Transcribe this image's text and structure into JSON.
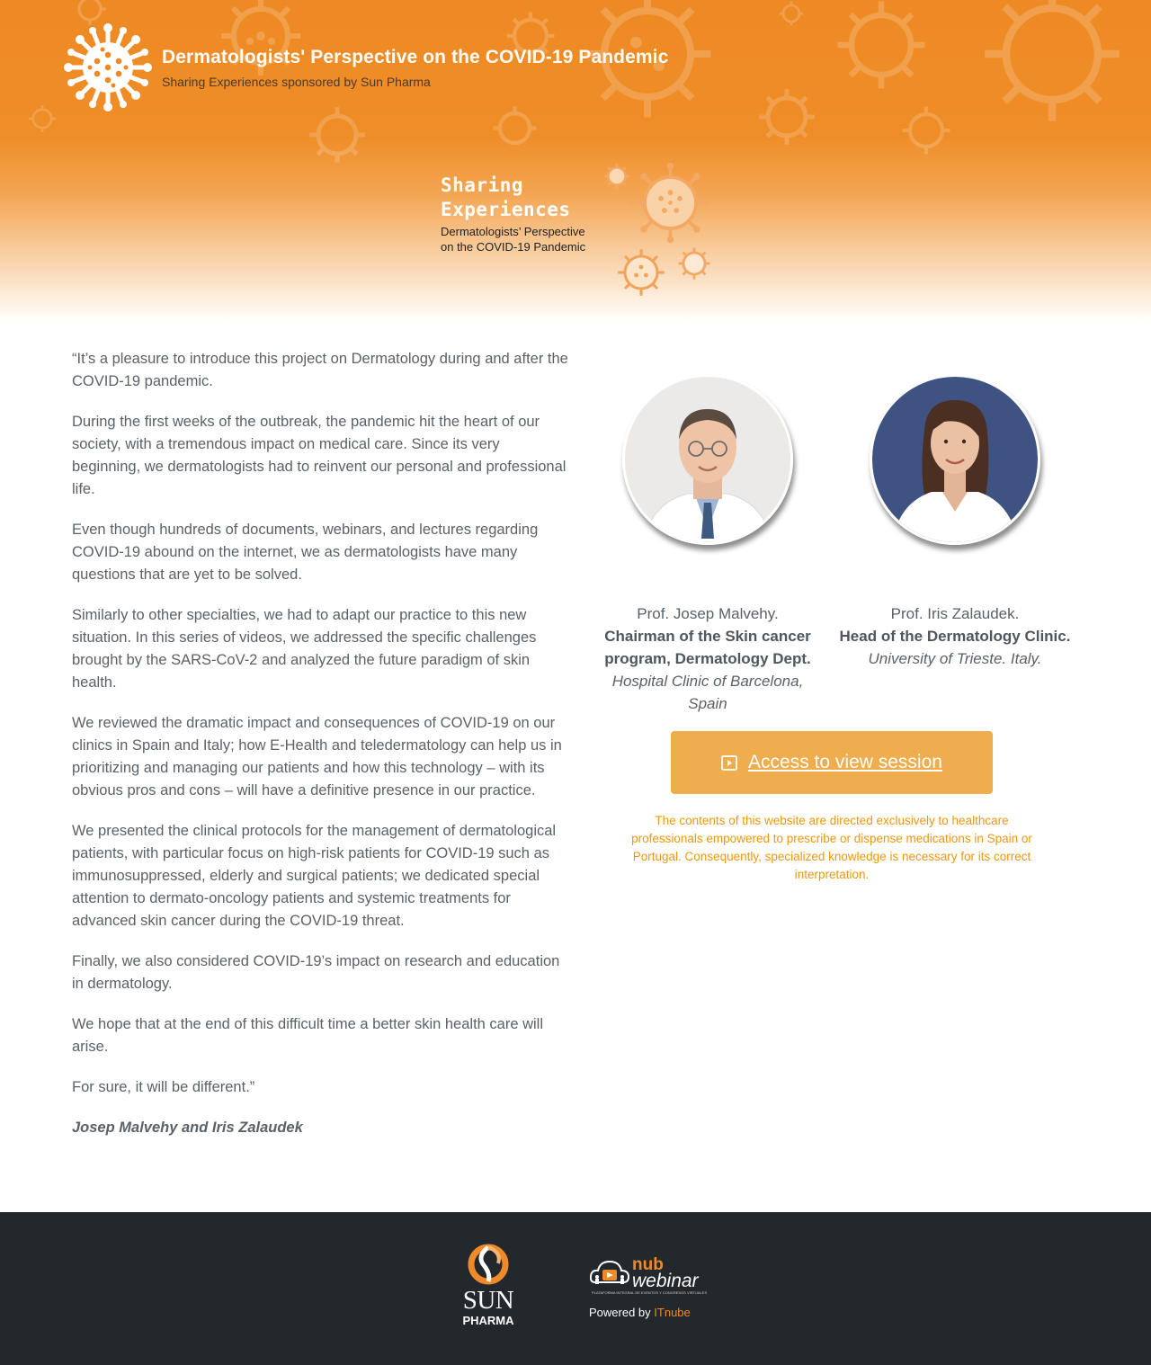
{
  "header": {
    "title": "Dermatologists' Perspective on the COVID-19 Pandemic",
    "subtitle": "Sharing Experiences sponsored by Sun Pharma",
    "logo_icon": "virus-icon",
    "hero": {
      "line1": "Sharing",
      "line2": "Experiences",
      "line3": "Dermatologists’ Perspective",
      "line4": "on the COVID-19 Pandemic"
    }
  },
  "intro": {
    "paragraphs": [
      "“It’s a pleasure to introduce this project on Dermatology during and after the COVID-19 pandemic.",
      "During the first weeks of the outbreak, the pandemic hit the heart of our society, with a tremendous impact on medical care. Since its very beginning, we dermatologists had to reinvent our personal and professional life.",
      "Even though hundreds of documents, webinars, and lectures regarding COVID-19 abound on the internet, we as dermatologists have many questions that are yet to be solved.",
      "Similarly to other specialties, we had to adapt our practice to this new situation. In this series of videos, we addressed the specific challenges brought by the SARS-CoV-2 and analyzed the future paradigm of skin health.",
      "We reviewed the dramatic impact and consequences of COVID-19 on our clinics in Spain and Italy; how E-Health and teledermatology can help us in prioritizing and managing our patients and how this technology – with its obvious pros and cons – will have a definitive presence in our practice.",
      "We presented the clinical protocols for the management of dermatological patients, with particular focus on high-risk patients for COVID-19 such as immunosuppressed, elderly and surgical patients; we dedicated special attention to dermato-oncology patients and systemic treatments for advanced skin cancer during the COVID-19 threat.",
      "Finally, we also considered COVID-19’s impact on research and education in dermatology.",
      "We hope that at the end of this difficult time a better skin health care will arise.",
      "For sure, it will be different.”"
    ],
    "signature": "Josep Malvehy and Iris Zalaudek"
  },
  "speakers": [
    {
      "name": "Prof. Josep Malvehy.",
      "role": "Chairman of the Skin cancer program, Dermatology Dept.",
      "institution": "Hospital Clinic of Barcelona, Spain"
    },
    {
      "name": "Prof. Iris Zalaudek.",
      "role": "Head of the Dermatology Clinic.",
      "institution": "University of Trieste. Italy."
    }
  ],
  "cta": {
    "label": "Access to view session",
    "icon": "play-icon",
    "color": "#f0ad4e"
  },
  "disclaimer": "The contents of this website are directed exclusively to healthcare professionals empowered to prescribe or dispense medications in Spain or Portugal. Consequently, specialized knowledge is necessary for its correct interpretation.",
  "footer": {
    "sponsor_logo": {
      "word": "SUN",
      "sub": "PHARMA"
    },
    "platform_logo": {
      "nub": "nub",
      "webinar": "webinar",
      "tagline": "PLATAFORMA INTEGRAL DE EVENTOS Y CONGRESOS VIRTUALES"
    },
    "powered_prefix": "Powered by",
    "powered_link": "ITnube"
  },
  "colors": {
    "accent_orange": "#ee8a24",
    "button": "#f0ad4e",
    "footer_bg": "#23282c",
    "text": "#5a6268"
  }
}
